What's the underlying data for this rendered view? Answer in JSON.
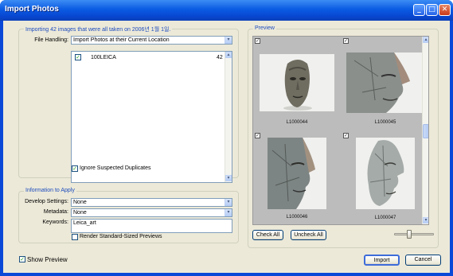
{
  "window": {
    "title": "Import Photos"
  },
  "import_group": {
    "legend": "Importing 42 images that were all taken on 2006년 1월 1일.",
    "file_handling_label": "File Handling:",
    "file_handling_value": "Import Photos at their Current Location",
    "folders": [
      {
        "name": "100LEICA",
        "count": "42",
        "checked": true
      }
    ],
    "ignore_duplicates_label": "Ignore Suspected Duplicates"
  },
  "info_group": {
    "legend": "Information to Apply",
    "develop_label": "Develop Settings:",
    "develop_value": "None",
    "metadata_label": "Metadata:",
    "metadata_value": "None",
    "keywords_label": "Keywords:",
    "keywords_value": "Leica_art",
    "render_label": "Render Standard-Sized Previews"
  },
  "preview": {
    "legend": "Preview",
    "items": [
      {
        "caption": "L1000044"
      },
      {
        "caption": "L1000045"
      },
      {
        "caption": "L1000046"
      },
      {
        "caption": "L1000047"
      }
    ],
    "check_all": "Check All",
    "uncheck_all": "Uncheck All",
    "thumbnail_size_fraction": 0.35
  },
  "footer": {
    "show_preview": "Show Preview",
    "import": "Import",
    "cancel": "Cancel"
  },
  "glyphs": {
    "check": "✓",
    "down": "▾",
    "up": "▴",
    "min": "_",
    "max": "□",
    "close": "✕"
  },
  "icons": [
    "minimize-icon",
    "maximize-icon",
    "close-icon",
    "checkmark-icon",
    "dropdown-arrow-icon",
    "scroll-up-icon",
    "scroll-down-icon"
  ],
  "colors": {
    "titlebar": "#0b5be3",
    "legend_text": "#1c4bbd",
    "dialog_bg": "#ece9d8"
  }
}
